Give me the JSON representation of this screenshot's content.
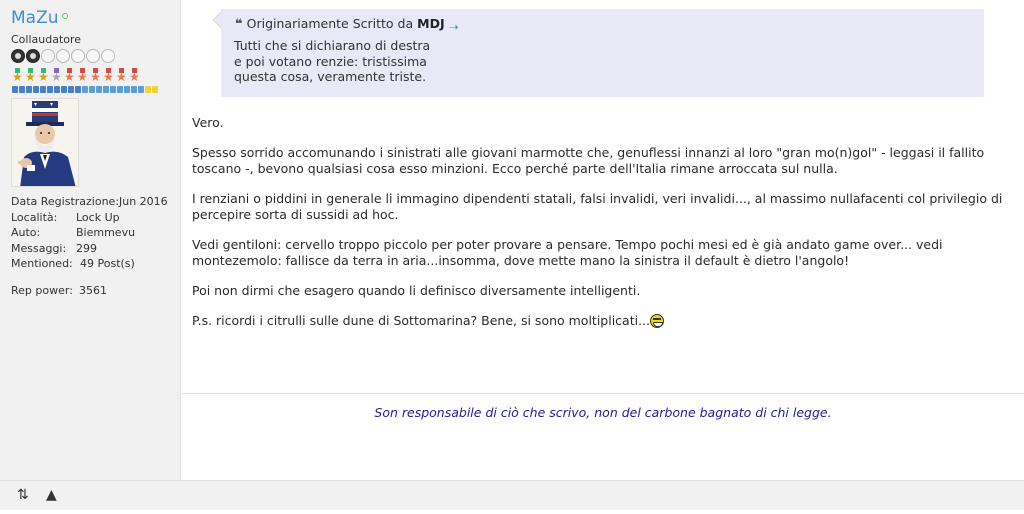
{
  "user": {
    "name": "MaZu",
    "title": "Collaudatore",
    "reputation_filled": 2,
    "reputation_total": 7
  },
  "profile_info": [
    {
      "label": "Data Registrazione:",
      "value": "Jun 2016"
    },
    {
      "label": "Località:",
      "value": "Lock Up"
    },
    {
      "label": "Auto:",
      "value": "Biemmevu"
    },
    {
      "label": "Messaggi:",
      "value": "299"
    },
    {
      "label": "Mentioned:",
      "value": "49 Post(s)"
    }
  ],
  "rep_power": {
    "label": "Rep power:",
    "value": "3561"
  },
  "quote": {
    "prefix": "Originariamente Scritto da",
    "author": "MDJ",
    "lines": [
      "Tutti che si dichiarano di destra",
      "e poi votano renzie: tristissima",
      "questa cosa, veramente triste."
    ]
  },
  "post": {
    "paragraphs": [
      "Vero.",
      "Spesso sorrido accomunando i sinistrati alle giovani marmotte che, genuflessi innanzi al loro \"gran mo(n)gol\" - leggasi il fallito toscano -, bevono qualsiasi cosa esso minzioni. Ecco perché parte dell'Italia rimane arroccata sul nulla.",
      "I renziani o piddini in generale li immagino dipendenti statali, falsi invalidi, veri invalidi..., al massimo nullafacenti col privilegio di percepire sorta di sussidi ad hoc.",
      "Vedi gentiloni: cervello troppo piccolo per poter provare a pensare. Tempo pochi mesi ed è già andato game over... vedi montezemolo: fallisce da terra in aria...insomma, dove mette mano la sinistra il default è dietro l'angolo!",
      "Poi non dirmi che esagero quando li definisco diversamente intelligenti.",
      "P.s. ricordi i citrulli sulle dune di Sottomarina? Bene, si sono moltiplicati..."
    ]
  },
  "signature": "Son responsabile di ciò che scrivo, non del carbone bagnato di chi legge.",
  "colors": {
    "username": "#3d8fd6",
    "signature": "#1e1e96",
    "quote_bg": "#e8e8f7",
    "sidebar_bg": "#f1f1f1"
  },
  "icons": {
    "footer": [
      "sort-arrows-icon",
      "warning-icon"
    ],
    "post_end": "laughing-smiley-icon",
    "quote_link": "arrow-right-icon"
  }
}
